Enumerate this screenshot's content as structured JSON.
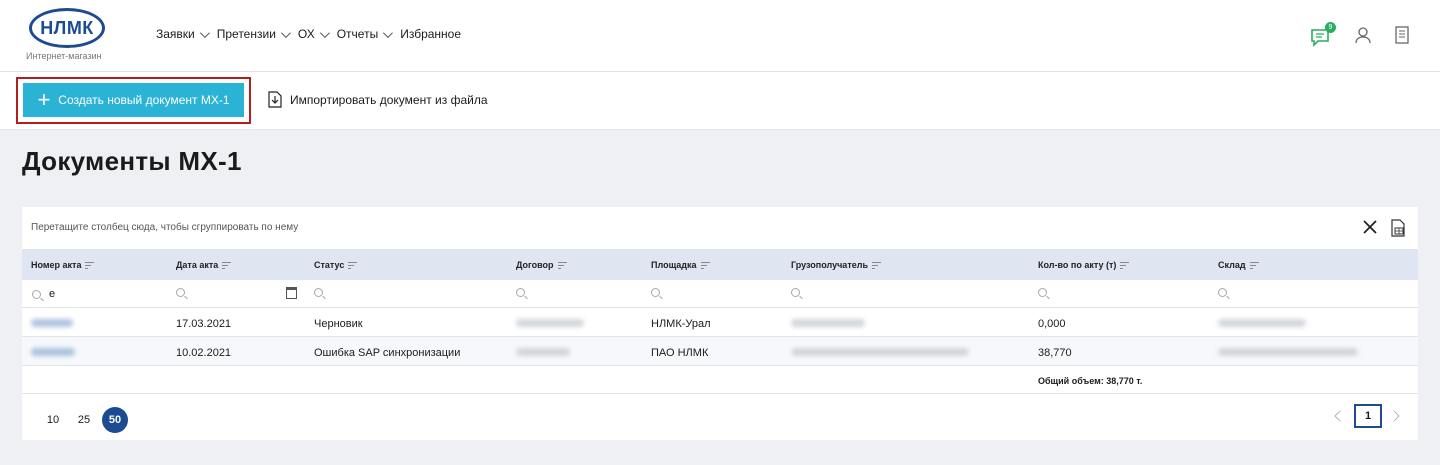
{
  "logo": {
    "text": "НЛМК",
    "subtitle": "Интернет-магазин"
  },
  "nav": [
    {
      "label": "Заявки",
      "has_dropdown": true
    },
    {
      "label": "Претензии",
      "has_dropdown": true
    },
    {
      "label": "ОХ",
      "has_dropdown": true
    },
    {
      "label": "Отчеты",
      "has_dropdown": true
    },
    {
      "label": "Избранное",
      "has_dropdown": false
    }
  ],
  "header_icons": {
    "chat_badge": "9",
    "icons": [
      "chat-icon",
      "user-icon",
      "notebook-icon"
    ],
    "accent": "#27ae60"
  },
  "toolbar": {
    "create_label": "Создать новый документ МХ-1",
    "import_label": "Импортировать документ из файла",
    "create_color": "#2bb3d6",
    "highlight_color": "#b21e1e"
  },
  "page_title": "Документы МХ-1",
  "grid": {
    "group_hint": "Перетащите столбец сюда, чтобы сгруппировать по нему",
    "columns": [
      "Номер акта",
      "Дата акта",
      "Статус",
      "Договор",
      "Площадка",
      "Грузополучатель",
      "Кол-во по акту (т)",
      "Склад"
    ],
    "filter_values": {
      "act_number": "e"
    },
    "rows": [
      {
        "date": "17.03.2021",
        "status": "Черновик",
        "site": "НЛМК-Урал",
        "qty": "0,000"
      },
      {
        "date": "10.02.2021",
        "status": "Ошибка SAP синхронизации",
        "site": "ПАО НЛМК",
        "qty": "38,770"
      }
    ],
    "summary": "Общий объем: 38,770 т."
  },
  "pager": {
    "sizes": [
      "10",
      "25",
      "50"
    ],
    "active_size": "50",
    "current_page": "1"
  },
  "colors": {
    "brand": "#1d4b91",
    "header_row": "#dfe6f2",
    "page_bg": "#eef0f3"
  }
}
